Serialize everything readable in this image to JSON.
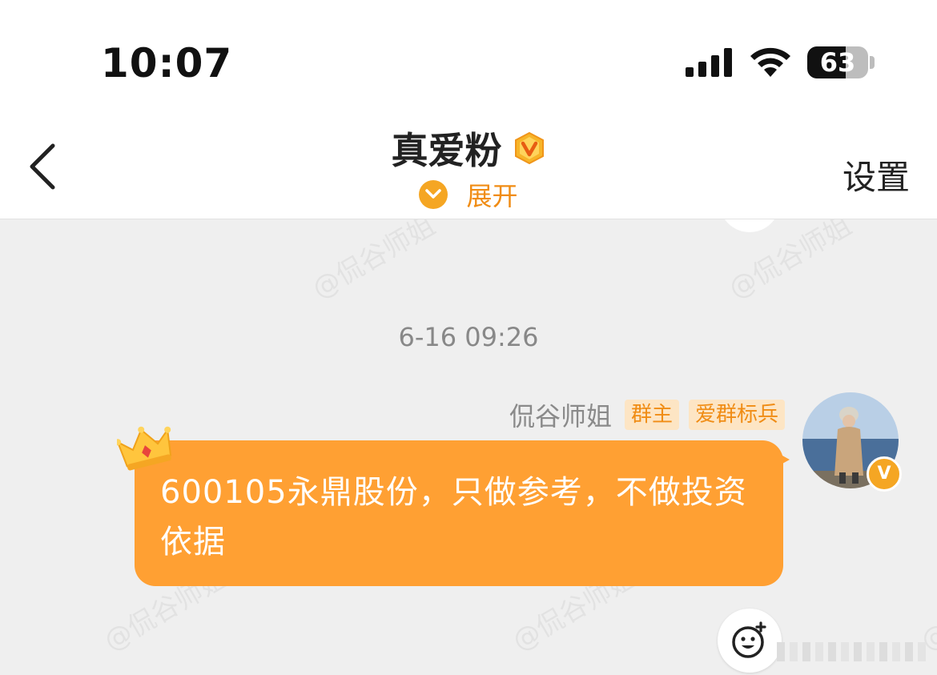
{
  "status_bar": {
    "time": "10:07",
    "battery_level": "63",
    "battery_fraction": 0.63
  },
  "header": {
    "back_icon": "chevron-left-icon",
    "title": "真爱粉",
    "title_badge_icon": "vip-v-badge-icon",
    "expand_label": "展开",
    "settings_label": "设置"
  },
  "chat": {
    "watermark_text": "@侃谷师姐",
    "timestamp": "6-16 09:26",
    "messages": [
      {
        "sender": "侃谷师姐",
        "tags": [
          "群主",
          "爱群标兵"
        ],
        "avatar_badge": "V",
        "text": "600105永鼎股份，只做参考，不做投资依据",
        "decoration_icon": "crown-icon"
      }
    ]
  },
  "colors": {
    "accent": "#f5a623",
    "bubble": "#ffa033",
    "tag_text": "#f08c14",
    "tag_bg": "#fde5c4",
    "background": "#efefef"
  }
}
